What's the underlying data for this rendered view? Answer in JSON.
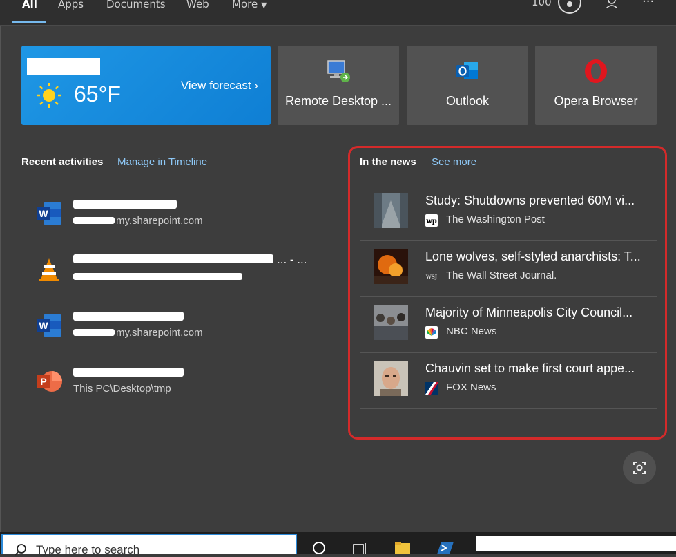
{
  "tabs": [
    {
      "label": "All",
      "active": true
    },
    {
      "label": "Apps"
    },
    {
      "label": "Documents"
    },
    {
      "label": "Web"
    },
    {
      "label": "More"
    }
  ],
  "top_right": {
    "points": "100"
  },
  "weather": {
    "temperature": "65°F",
    "forecast_link": "View forecast"
  },
  "apps": [
    {
      "label": "Remote Desktop ...",
      "icon": "remote-desktop-icon"
    },
    {
      "label": "Outlook",
      "icon": "outlook-icon"
    },
    {
      "label": "Opera Browser",
      "icon": "opera-icon"
    }
  ],
  "recent": {
    "title": "Recent activities",
    "link": "Manage in Timeline",
    "items": [
      {
        "title": "",
        "path": "my.sharepoint.com",
        "icon": "word-icon"
      },
      {
        "title": "... - ...",
        "path": "",
        "icon": "vlc-icon"
      },
      {
        "title": "",
        "path": "my.sharepoint.com",
        "icon": "word-icon"
      },
      {
        "title": "",
        "path": "This PC\\Desktop\\tmp",
        "icon": "powerpoint-icon"
      }
    ]
  },
  "news": {
    "title": "In the news",
    "link": "See more",
    "items": [
      {
        "headline": "Study: Shutdowns prevented 60M vi...",
        "source": "The Washington Post",
        "source_icon": "wp"
      },
      {
        "headline": "Lone wolves, self-styled anarchists: T...",
        "source": "The Wall Street Journal.",
        "source_icon": "WSJ"
      },
      {
        "headline": "Majority of Minneapolis City Council...",
        "source": "NBC News",
        "source_icon": "nbc"
      },
      {
        "headline": "Chauvin set to make first court appe...",
        "source": "FOX News",
        "source_icon": "fox"
      }
    ]
  },
  "taskbar": {
    "search_placeholder": "Type here to search"
  },
  "colors": {
    "accent": "#76b9ed",
    "highlight_border": "#d42a2a",
    "weather_tile": "#1a8ee0"
  }
}
